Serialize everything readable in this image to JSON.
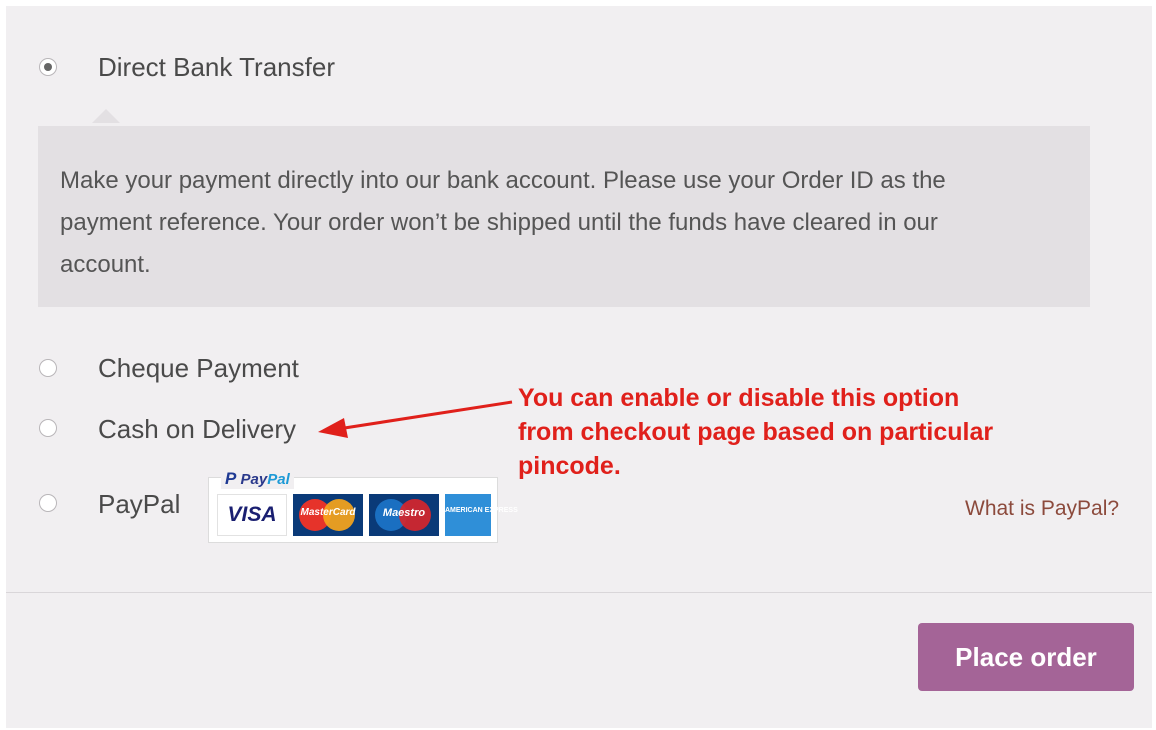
{
  "payment_methods": [
    {
      "label": "Direct Bank Transfer",
      "selected": true
    },
    {
      "label": "Cheque Payment",
      "selected": false
    },
    {
      "label": "Cash on Delivery",
      "selected": false
    },
    {
      "label": "PayPal",
      "selected": false
    }
  ],
  "bank_transfer_description": {
    "line1": "Make your payment directly into our bank account. Please use your Order ID as the",
    "line2": "payment reference. Your order won’t be shipped until the funds have cleared in our",
    "line3": "account."
  },
  "paypal": {
    "logo_text_pay": "Pay",
    "logo_text_pal": "Pal",
    "logo_letter": "P",
    "cards": {
      "visa": "VISA",
      "mastercard": "MasterCard",
      "maestro": "Maestro",
      "amex": "AMERICAN EXPRESS"
    },
    "what_is_link": "What is PayPal?"
  },
  "annotation": {
    "line1": "You can enable or disable this option",
    "line2": "from checkout page based on particular",
    "line3": "pincode."
  },
  "place_order_label": "Place order",
  "colors": {
    "panel_bg": "#f1eff1",
    "description_bg": "#e3e0e3",
    "button_bg": "#a46497",
    "annotation_red": "#e0201b",
    "link": "#8c4a3c"
  }
}
